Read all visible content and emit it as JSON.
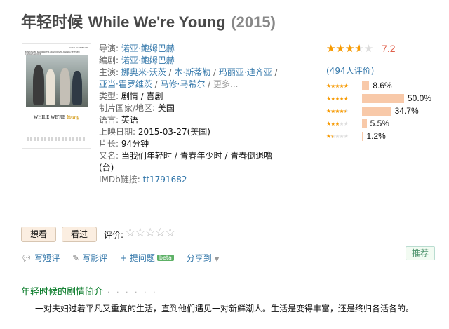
{
  "header": {
    "title_zh": "年轻时候",
    "title_en": "While We're Young",
    "year": "(2015)"
  },
  "poster": {
    "credit": "NOAH BAUMBACH",
    "cast_line": "BEN STILLER   NAOMI WATTS   ADAM DRIVER   AMANDA SEYFRIED   CHARLES GRODIN",
    "title_a": "WHILE WE'RE",
    "title_b": "Young"
  },
  "info": {
    "director_label": "导演:",
    "director": "诺亚·鲍姆巴赫",
    "writer_label": "编剧:",
    "writer": "诺亚·鲍姆巴赫",
    "cast_label": "主演:",
    "cast": [
      "娜奥米·沃茨",
      "本·斯蒂勒",
      "玛丽亚·迪齐亚",
      "亚当·霍罗维茨",
      "马修·马希尔"
    ],
    "more": "更多...",
    "genre_label": "类型:",
    "genre": "剧情 / 喜剧",
    "country_label": "制片国家/地区:",
    "country": "美国",
    "language_label": "语言:",
    "language": "英语",
    "release_label": "上映日期:",
    "release": "2015-03-27(美国)",
    "runtime_label": "片长:",
    "runtime": "94分钟",
    "aka_label": "又名:",
    "aka": "当我们年轻时 / 青春年少时 / 青春倒退噜(台)",
    "imdb_label": "IMDb链接:",
    "imdb": "tt1791682"
  },
  "rating": {
    "score": "7.2",
    "score_fraction": 0.72,
    "votes": "(494人评价)",
    "distribution": [
      {
        "stars": 5,
        "pct": "8.6%",
        "value": 8.6
      },
      {
        "stars": 4,
        "pct": "50.0%",
        "value": 50.0
      },
      {
        "stars": 3,
        "pct": "34.7%",
        "value": 34.7
      },
      {
        "stars": 2,
        "pct": "5.5%",
        "value": 5.5
      },
      {
        "stars": 1,
        "pct": "1.2%",
        "value": 1.2
      }
    ]
  },
  "actions": {
    "want": "想看",
    "seen": "看过",
    "rate_label": "评价:",
    "short_review": "写短评",
    "long_review": "写影评",
    "ask": "+ 提问题",
    "beta": "beta",
    "share": "分享到",
    "recommend": "推荐"
  },
  "synopsis": {
    "title": "年轻时候的剧情简介",
    "dots": "· · · · · ·",
    "text": "一对夫妇过着平凡又重复的生活，直到他们遇见一对新鲜潮人。生活是变得丰富，还是终归各活各的。"
  },
  "colors": {
    "link": "#3377aa",
    "star": "#f99b01",
    "bar": "#f8c9a9",
    "section_title": "#007722"
  }
}
